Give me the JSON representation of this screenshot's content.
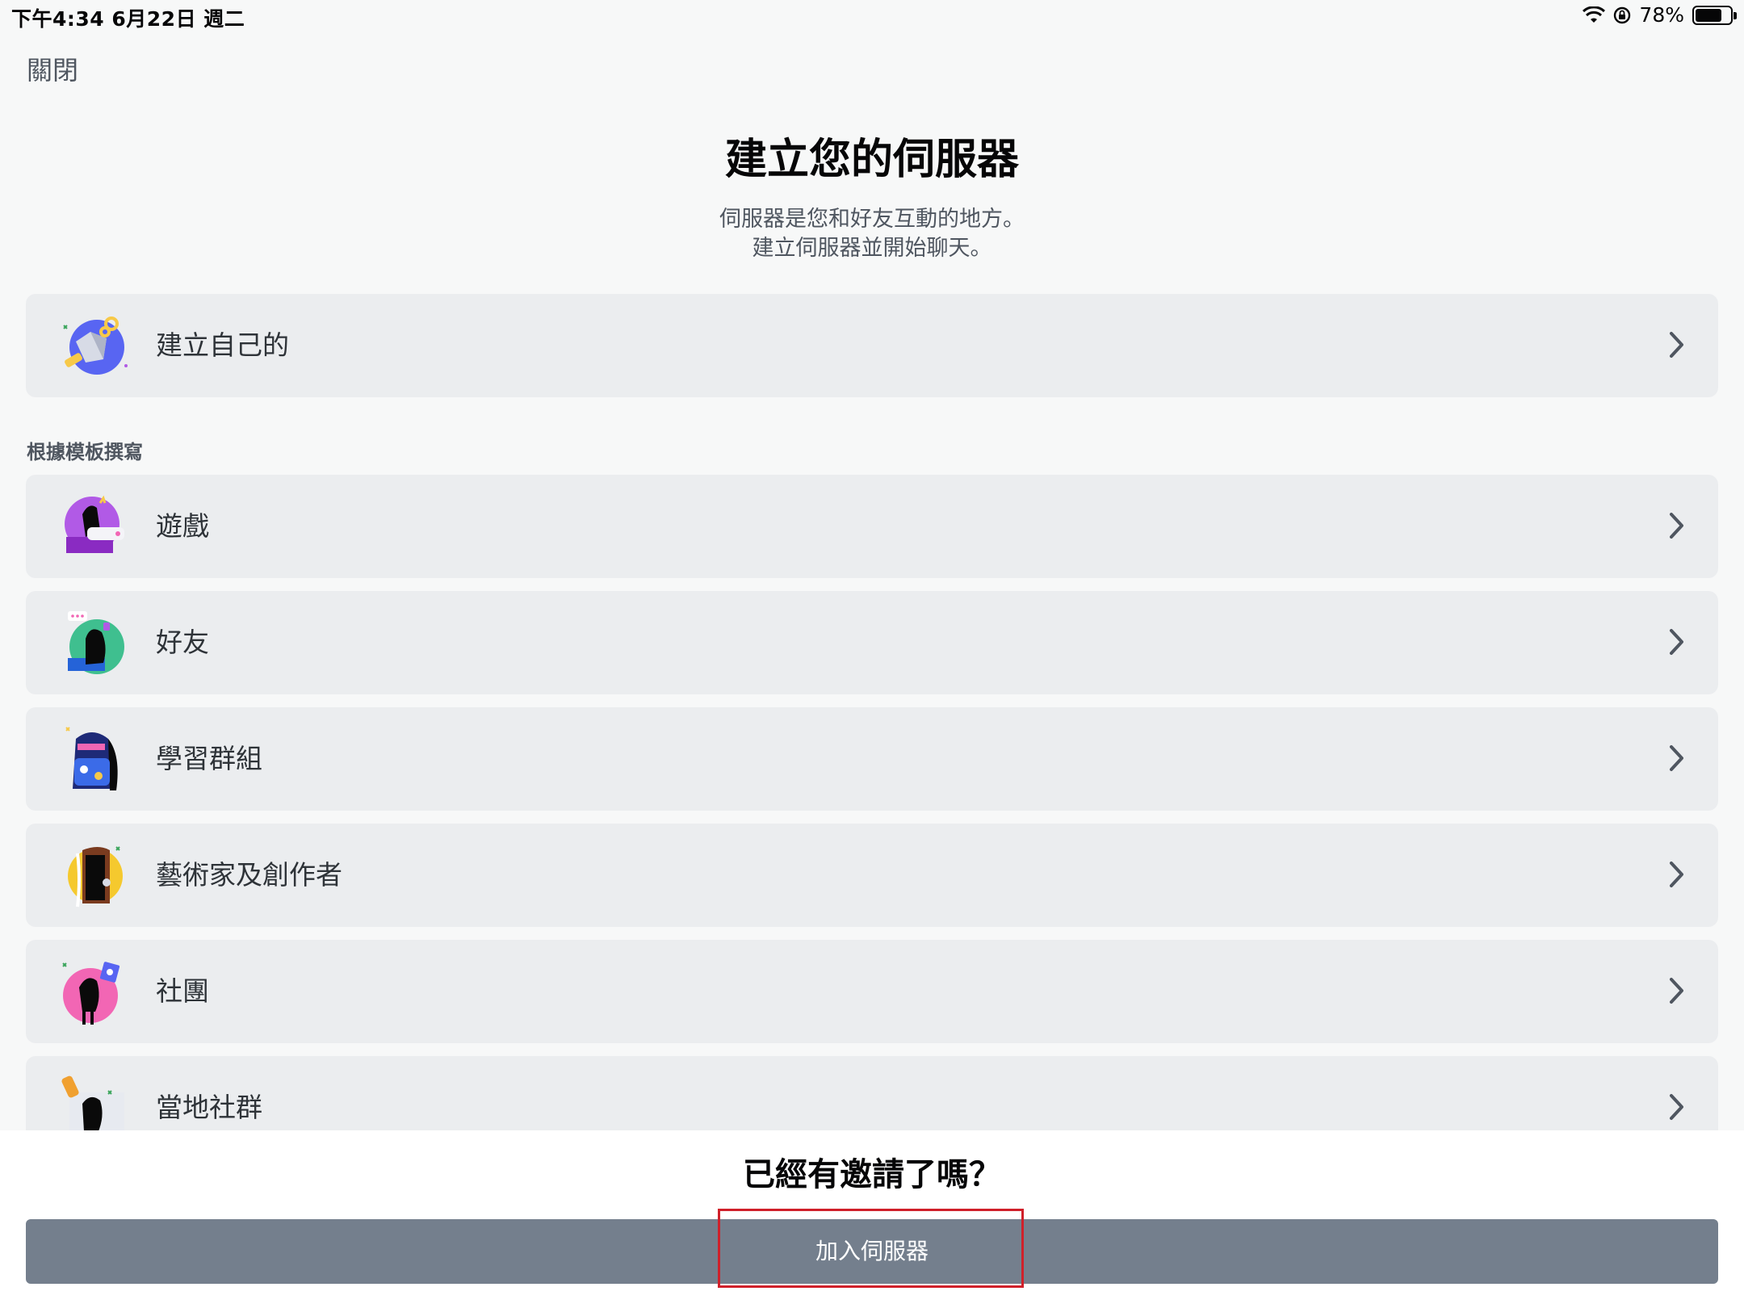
{
  "status_bar": {
    "time_date": "下午4:34   6月22日 週二",
    "battery_percent": "78%",
    "battery_level": 0.78,
    "icons": [
      "wifi-icon",
      "orientation-lock-icon",
      "battery-icon"
    ]
  },
  "close_label": "關閉",
  "header": {
    "title": "建立您的伺服器",
    "subtitle_line1": "伺服器是您和好友互動的地方。",
    "subtitle_line2": "建立伺服器並開始聊天。"
  },
  "create_own": {
    "label": "建立自己的",
    "icon": "globe-create-icon"
  },
  "template_section_label": "根據模板撰寫",
  "templates": [
    {
      "label": "遊戲",
      "icon": "gaming-icon",
      "color": "#b15ae6"
    },
    {
      "label": "好友",
      "icon": "friends-icon",
      "color": "#3fbf8f"
    },
    {
      "label": "學習群組",
      "icon": "study-backpack-icon",
      "color": "#2d3fa8"
    },
    {
      "label": "藝術家及創作者",
      "icon": "artists-icon",
      "color": "#f5c92e"
    },
    {
      "label": "社團",
      "icon": "club-icon",
      "color": "#f266b4"
    },
    {
      "label": "當地社群",
      "icon": "local-community-icon",
      "color": "#f0a030"
    }
  ],
  "footer": {
    "question": "已經有邀請了嗎？",
    "join_button": "加入伺服器"
  },
  "colors": {
    "background": "#f7f8f8",
    "card": "#ebedef",
    "join_button": "#747f8d",
    "highlight": "#d0202a"
  }
}
